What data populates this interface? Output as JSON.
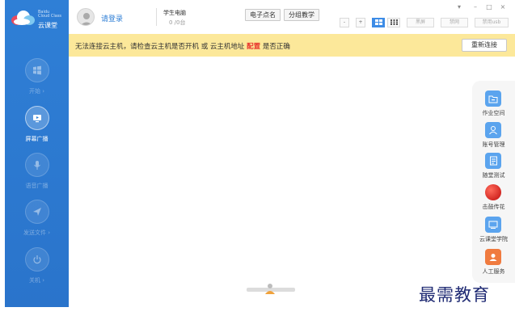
{
  "sidebar": {
    "brand_en_line1": "Baidu",
    "brand_en_line2": "Cloud Class",
    "brand_cn": "云课堂",
    "items": [
      {
        "label": "开始 ›",
        "icon": "windows-icon",
        "active": false
      },
      {
        "label": "屏幕广播",
        "icon": "screen-broadcast-icon",
        "active": true
      },
      {
        "label": "语音广播",
        "icon": "microphone-icon",
        "active": false
      },
      {
        "label": "发送文件 ›",
        "icon": "send-icon",
        "active": false
      },
      {
        "label": "关机 ›",
        "icon": "power-icon",
        "active": false
      }
    ]
  },
  "header": {
    "login_label": "请登录",
    "pc_label": "学生电脑",
    "pc_count": "0 /0台",
    "rollcall_button": "电子点名",
    "group_button": "分组教学",
    "small_buttons": [
      "-",
      "+"
    ],
    "view_icons": [
      "grid-large-icon",
      "grid-small-icon"
    ],
    "text_buttons": [
      "黑屏",
      "禁网",
      "禁用usb"
    ],
    "window_controls": [
      "▾",
      "–",
      "□",
      "×"
    ]
  },
  "warning": {
    "text_before": "无法连接云主机，请检查云主机是否开机 或 云主机地址",
    "config_link": "配置",
    "text_after": "是否正确",
    "reconnect_button": "重新连接"
  },
  "right_panel": {
    "items": [
      {
        "label": "作业空间",
        "icon": "folder-icon",
        "color": "#5ba4ee"
      },
      {
        "label": "账号管理",
        "icon": "user-icon",
        "color": "#5ba4ee"
      },
      {
        "label": "随堂测试",
        "icon": "document-icon",
        "color": "#5ba4ee"
      },
      {
        "label": "击鼓传花",
        "icon": "drum-icon",
        "color": "#e01818"
      },
      {
        "label": "云课堂学院",
        "icon": "monitor-icon",
        "color": "#5ba4ee"
      },
      {
        "label": "人工服务",
        "icon": "service-icon",
        "color": "#f07b3f"
      }
    ]
  },
  "colors": {
    "sidebar": "#2f7fd6",
    "warning_bg": "#fce89a",
    "accent": "#3d8ce6",
    "config_red": "#e8322b"
  },
  "watermark": "最需教育"
}
